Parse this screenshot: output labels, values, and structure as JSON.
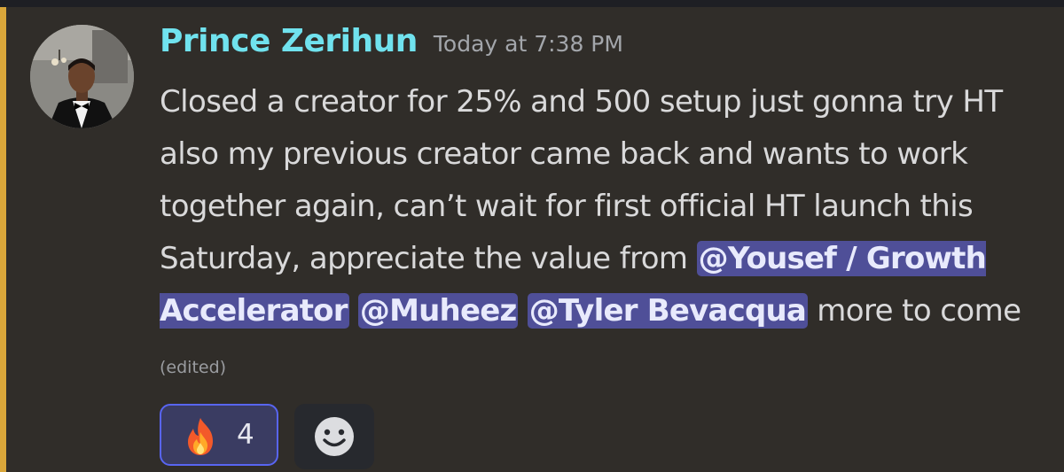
{
  "message": {
    "username": "Prince Zerihun",
    "timestamp": "Today at 7:38 PM",
    "text_part1": "Closed a creator for 25% and 500 setup just gonna try HT also my previous creator came back and wants to work together again,  can’t wait for first official HT launch this Saturday, appreciate the value from ",
    "mentions": [
      "@Yousef / Growth Accelerator",
      "@Muheez",
      "@Tyler Bevacqua"
    ],
    "text_part2": " more to come",
    "edited_label": "(edited)"
  },
  "reactions": [
    {
      "emoji": "fire-icon",
      "count": "4"
    }
  ],
  "add_reaction_icon": "smiley-icon",
  "colors": {
    "background": "#302d29",
    "highlight_bar": "#d9a63a",
    "username": "#70e2ee",
    "mention_bg": "#4f4f98",
    "reaction_border": "#5865f2"
  }
}
